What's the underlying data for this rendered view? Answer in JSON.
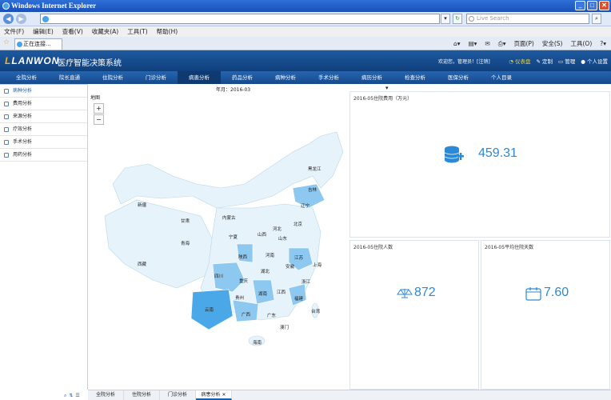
{
  "browser": {
    "title": "Windows Internet Explorer",
    "search_placeholder": "Live Search",
    "menu": [
      "文件(F)",
      "编辑(E)",
      "查看(V)",
      "收藏夹(A)",
      "工具(T)",
      "帮助(H)"
    ],
    "tab_label": "正在连接...",
    "commands": [
      "页面(P)",
      "安全(S)",
      "工具(O)"
    ]
  },
  "app": {
    "logo": "LANWON",
    "title": "医疗智能决策系统",
    "user_info": "欢迎您，管理员！[注销]",
    "header_actions": [
      "仪表盘",
      "定制",
      "管理",
      "个人设置"
    ],
    "nav": [
      "全院分析",
      "院长直通",
      "住院分析",
      "门诊分析",
      "病患分析",
      "药品分析",
      "病种分析",
      "手术分析",
      "病历分析",
      "检查分析",
      "医保分析",
      "个人目录"
    ],
    "active_nav": "病患分析"
  },
  "sidebar": {
    "items": [
      "病种分析",
      "费用分析",
      "来源分析",
      "疗效分析",
      "手术分析",
      "用药分析"
    ],
    "active": "病种分析"
  },
  "filter": {
    "month_label": "年月：",
    "month_value": "2016-03"
  },
  "map": {
    "label": "地图",
    "provinces": [
      "黑龙江",
      "吉林",
      "辽宁",
      "内蒙古",
      "新疆",
      "甘肃",
      "宁夏",
      "北京",
      "河北",
      "山西",
      "山东",
      "青海",
      "陕西",
      "河南",
      "江苏",
      "安徽",
      "上海",
      "西藏",
      "四川",
      "湖北",
      "重庆",
      "浙江",
      "贵州",
      "湖南",
      "江西",
      "福建",
      "云南",
      "广西",
      "广东",
      "台湾",
      "澳门",
      "海南"
    ],
    "highlighted": [
      "吉林",
      "辽宁",
      "陕西",
      "江苏",
      "安徽",
      "四川",
      "湖南",
      "福建",
      "云南",
      "广西"
    ]
  },
  "metrics": {
    "cost": {
      "title": "2016-05住院费用（万元）",
      "value": "459.31"
    },
    "patients": {
      "title": "2016-05住院人数",
      "value": "872"
    },
    "avg_days": {
      "title": "2016-05平均住院天数",
      "value": "7.60"
    }
  },
  "bottom_tabs": [
    "全院分析",
    "住院分析",
    "门诊分析",
    "病患分析 ✕"
  ],
  "colors": {
    "accent": "#2a8ad8",
    "header": "#1e5aa0",
    "map_fill": "#e6f3fb",
    "map_highlight": "#4aa8e8"
  }
}
